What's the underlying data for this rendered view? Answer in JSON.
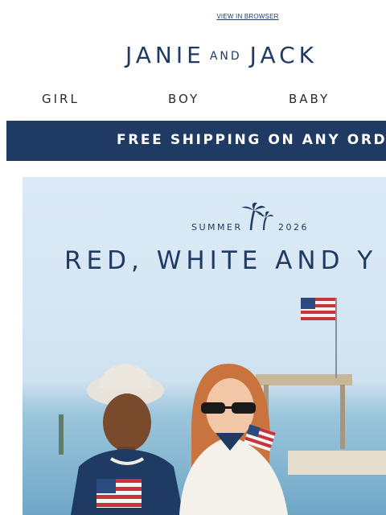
{
  "header": {
    "view_in_browser": "VIEW IN BROWSER",
    "logo": {
      "left": "JANIE",
      "middle": "AND",
      "right": "JACK"
    }
  },
  "nav": {
    "items": [
      "GIRL",
      "BOY",
      "BABY"
    ]
  },
  "banner": {
    "text": "FREE SHIPPING ON ANY ORDER"
  },
  "hero": {
    "season": "SUMMER",
    "year": "2026",
    "headline": "RED, WHITE AND Y",
    "icon": "palm-trees-icon"
  },
  "colors": {
    "navy": "#1f3a63",
    "white": "#ffffff",
    "sky": "#dbeaf6",
    "flag_red": "#c8323b"
  }
}
